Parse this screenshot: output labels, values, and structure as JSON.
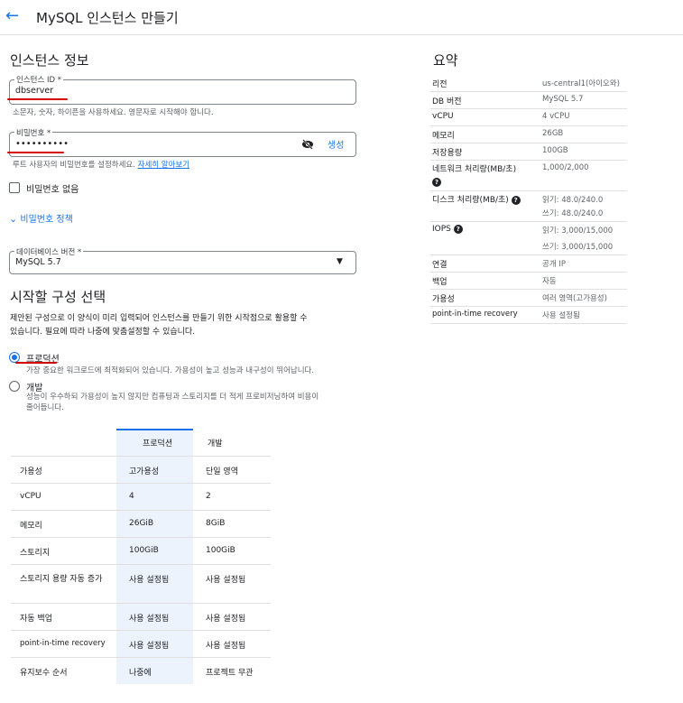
{
  "header": {
    "back_icon": "arrow-left-icon",
    "title": "MySQL 인스턴스 만들기"
  },
  "instance_info": {
    "section_title": "인스턴스 정보",
    "id_label": "인스턴스 ID *",
    "id_value": "dbserver",
    "id_hint": "소문자, 숫자, 하이픈을 사용하세요. 영문자로 시작해야 합니다.",
    "password_label": "비밀번호 *",
    "password_value": "••••••••••",
    "generate_label": "생성",
    "password_hint": "루트 사용자의 비밀번호를 설정하세요.",
    "learn_more": "자세히 알아보기",
    "no_password_label": "비밀번호 없음",
    "password_policy": "비밀번호 정책",
    "db_version_label": "데이터베이스 버전 *",
    "db_version_value": "MySQL 5.7"
  },
  "config": {
    "section_title": "시작할 구성 선택",
    "description_line1": "제안된 구성으로 이 양식이 미리 입력되어 인스턴스를 만들기 위한 시작점으로 활용할 수",
    "description_line2": "있습니다. 필요에 따라 나중에 맞춤설정할 수 있습니다.",
    "options": [
      {
        "label": "프로덕션",
        "desc": "가장 중요한 워크로드에 최적화되어 있습니다. 가용성이 높고 성능과 내구성이 뛰어납니다.",
        "selected": true
      },
      {
        "label": "개발",
        "desc1": "성능이 우수하되 가용성이 높지 않지만 컴퓨팅과 스토리지를 더 적게 프로비저닝하여 비용이",
        "desc2": "줄어듭니다.",
        "selected": false
      }
    ]
  },
  "comparison": {
    "headers": [
      "",
      "프로덕션",
      "개발"
    ],
    "rows": [
      [
        "가용성",
        "고가용성",
        "단일 영역"
      ],
      [
        "vCPU",
        "4",
        "2"
      ],
      [
        "메모리",
        "26GiB",
        "8GiB"
      ],
      [
        "스토리지",
        "100GiB",
        "100GiB"
      ],
      [
        "스토리지 용량 자동 증가",
        "사용 설정됨",
        "사용 설정됨"
      ],
      [
        "자동 백업",
        "사용 설정됨",
        "사용 설정됨"
      ],
      [
        "point-in-time recovery",
        "사용 설정됨",
        "사용 설정됨"
      ],
      [
        "유지보수 순서",
        "나중에",
        "프로젝트 무관"
      ]
    ]
  },
  "summary": {
    "title": "요약",
    "rows": [
      {
        "key": "리전",
        "value": "us-central1(아이오와)"
      },
      {
        "key": "DB 버전",
        "value": "MySQL 5.7"
      },
      {
        "key": "vCPU",
        "value": "4 vCPU"
      },
      {
        "key": "메모리",
        "value": "26GB"
      },
      {
        "key": "저장용량",
        "value": "100GB"
      },
      {
        "key": "네트워크 처리량(MB/초)",
        "value": "1,000/2,000"
      },
      {
        "key": "디스크 처리량(MB/초)",
        "value": "읽기: 48.0/240.0",
        "value2": "쓰기: 48.0/240.0"
      },
      {
        "key": "IOPS",
        "value": "읽기: 3,000/15,000",
        "value2": "쓰기: 3,000/15,000"
      },
      {
        "key": "연결",
        "value": "공개 IP"
      },
      {
        "key": "백업",
        "value": "자동"
      },
      {
        "key": "가용성",
        "value": "여러 영역(고가용성)"
      },
      {
        "key": "point-in-time recovery",
        "value": "사용 설정됨"
      }
    ]
  },
  "colors": {
    "accent": "#1a73e8",
    "annotation": "#d30000",
    "table_highlight": "#edf3fd"
  }
}
